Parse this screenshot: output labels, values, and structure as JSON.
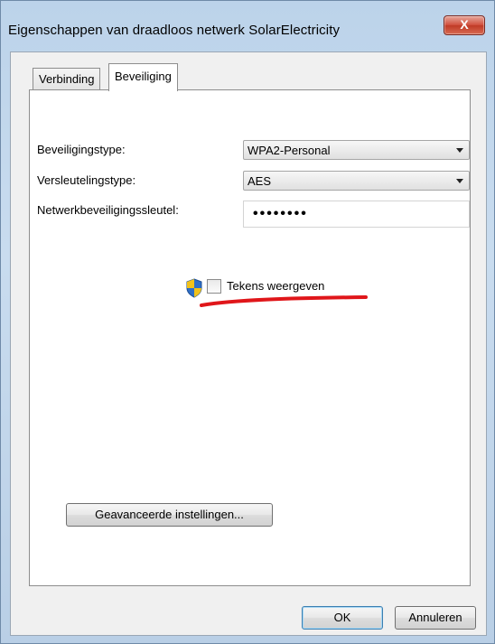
{
  "window": {
    "title": "Eigenschappen van draadloos netwerk SolarElectricity",
    "close_glyph": "X"
  },
  "tabs": [
    {
      "label": "Verbinding"
    },
    {
      "label": "Beveiliging"
    }
  ],
  "form": {
    "security_type_label": "Beveiligingstype:",
    "security_type_value": "WPA2-Personal",
    "encryption_type_label": "Versleutelingstype:",
    "encryption_type_value": "AES",
    "network_key_label": "Netwerkbeveiligingssleutel:",
    "network_key_value": "••••••••",
    "show_chars_label": "Tekens weergeven",
    "show_chars_checked": false
  },
  "buttons": {
    "advanced": "Geavanceerde instellingen...",
    "ok": "OK",
    "cancel": "Annuleren"
  },
  "colors": {
    "annotation_underline": "#e0161a",
    "shield_blue": "#2f6fc7",
    "shield_yellow": "#f2c21a"
  },
  "icons": {
    "shield": "uac-shield-icon",
    "chevron": "chevron-down-icon"
  }
}
